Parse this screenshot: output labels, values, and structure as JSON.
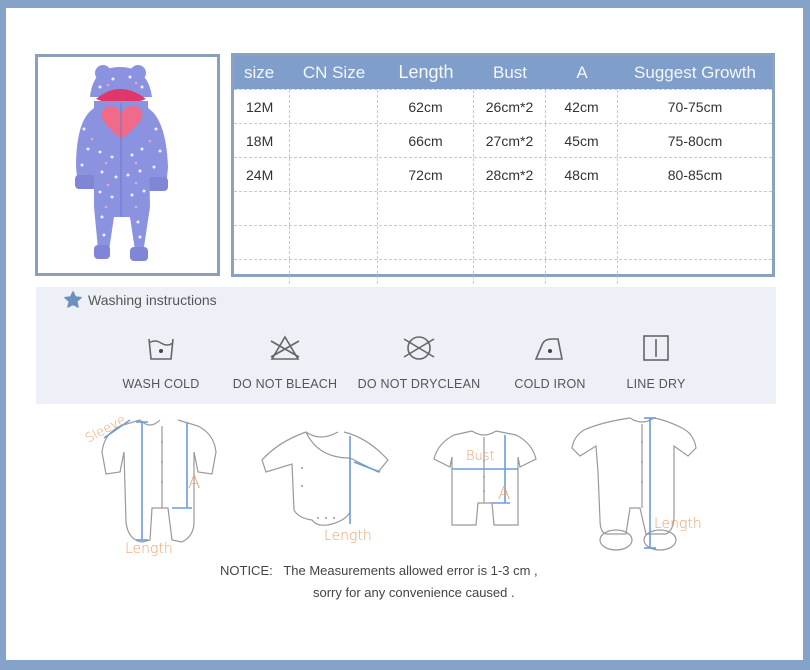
{
  "product_image": {
    "alt": "Purple polka-dot hooded baby romper with pink heart",
    "colors": {
      "body": "#8b93e0",
      "heart": "#f06a8a",
      "lining": "#e0366a"
    }
  },
  "size_table": {
    "headers": [
      "size",
      "CN Size",
      "Length",
      "Bust",
      "A",
      "Suggest Growth"
    ],
    "rows": [
      [
        "12M",
        "",
        "62cm",
        "26cm*2",
        "42cm",
        "70-75cm"
      ],
      [
        "18M",
        "",
        "66cm",
        "27cm*2",
        "45cm",
        "75-80cm"
      ],
      [
        "24M",
        "",
        "72cm",
        "28cm*2",
        "48cm",
        "80-85cm"
      ],
      [
        "",
        "",
        "",
        "",
        "",
        ""
      ],
      [
        "",
        "",
        "",
        "",
        "",
        ""
      ],
      [
        "",
        "",
        "",
        "",
        "",
        ""
      ]
    ],
    "header_color": "#7f9fca"
  },
  "washing": {
    "title": "Washing instructions",
    "title_icon": "star-icon",
    "items": [
      {
        "icon": "wash-cold-icon",
        "label": "WASH COLD"
      },
      {
        "icon": "do-not-bleach-icon",
        "label": "DO NOT BLEACH"
      },
      {
        "icon": "do-not-dryclean-icon",
        "label": "DO NOT DRYCLEAN"
      },
      {
        "icon": "cold-iron-icon",
        "label": "COLD IRON"
      },
      {
        "icon": "line-dry-icon",
        "label": "LINE DRY"
      }
    ]
  },
  "diagrams": {
    "labels": {
      "sleeve": "Sleeve",
      "length1": "Length",
      "a1": "A",
      "length2": "Length",
      "bust": "Bust",
      "a2": "A",
      "length3": "Length"
    }
  },
  "notice": {
    "line1": "NOTICE:   The Measurements allowed error is 1-3 cm ,",
    "line2": "sorry for any convenience caused ."
  }
}
